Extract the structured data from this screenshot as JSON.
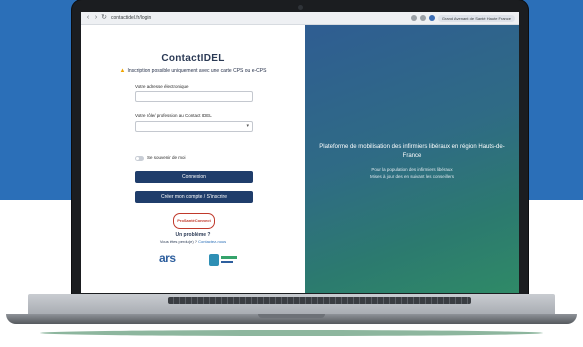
{
  "browser": {
    "url": "contactidel.fr/login",
    "profile_label": "Grand Avenant de Santé Haute France"
  },
  "form": {
    "brand": "ContactIDEL",
    "warning": "Inscription possible uniquement avec une carte CPS ou e-CPS",
    "email_label": "Votre adresse électronique",
    "email_value": "",
    "role_label": "Votre rôle/ profession au Contact IDEL",
    "role_value": "",
    "remember_label": "Se souvenir de moi",
    "login_button": "Connexion",
    "register_button": "Créer mon compte / S'inscrire",
    "badge_label": "ProSantéConnect",
    "help_title": "Un problème ?",
    "help_text": "Vous êtes perdu(e) ?",
    "help_link": "Contactez-nous",
    "logo_ars": "ars"
  },
  "hero": {
    "title": "Plateforme de mobilisation des infirmiers libéraux en région Hauts-de-France",
    "subtitle_line1": "Pour la population des infirmiers libéraux",
    "subtitle_line2": "Mises à jour des en suivant les conseillers"
  },
  "colors": {
    "brand_navy": "#1f3d6b",
    "page_blue": "#2b6fb8",
    "hero_gradient_start": "#2f5d92",
    "hero_gradient_end": "#2f8a67",
    "warning": "#f0a500"
  }
}
